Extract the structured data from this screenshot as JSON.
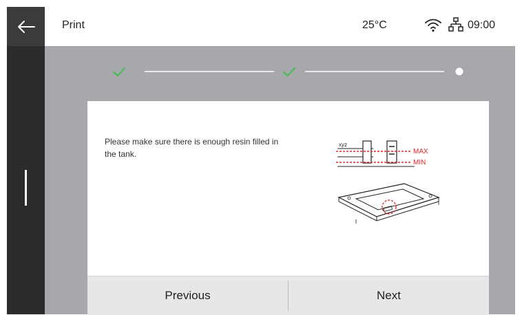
{
  "header": {
    "title": "Print",
    "temperature": "25°C",
    "time": "09:00",
    "icons": [
      "back-arrow-icon",
      "wifi-icon",
      "network-icon"
    ]
  },
  "stepper": {
    "steps": [
      {
        "state": "done",
        "icon": "check-icon"
      },
      {
        "state": "done",
        "icon": "check-icon"
      },
      {
        "state": "current",
        "icon": "dot-icon"
      }
    ],
    "accent": "#3fbf4f"
  },
  "dialog": {
    "message": "Please make sure there is enough resin filled in the tank.",
    "illustration": {
      "max_label": "MAX",
      "min_label": "MIN",
      "accent": "#e4262b"
    },
    "buttons": {
      "previous": "Previous",
      "next": "Next"
    }
  }
}
